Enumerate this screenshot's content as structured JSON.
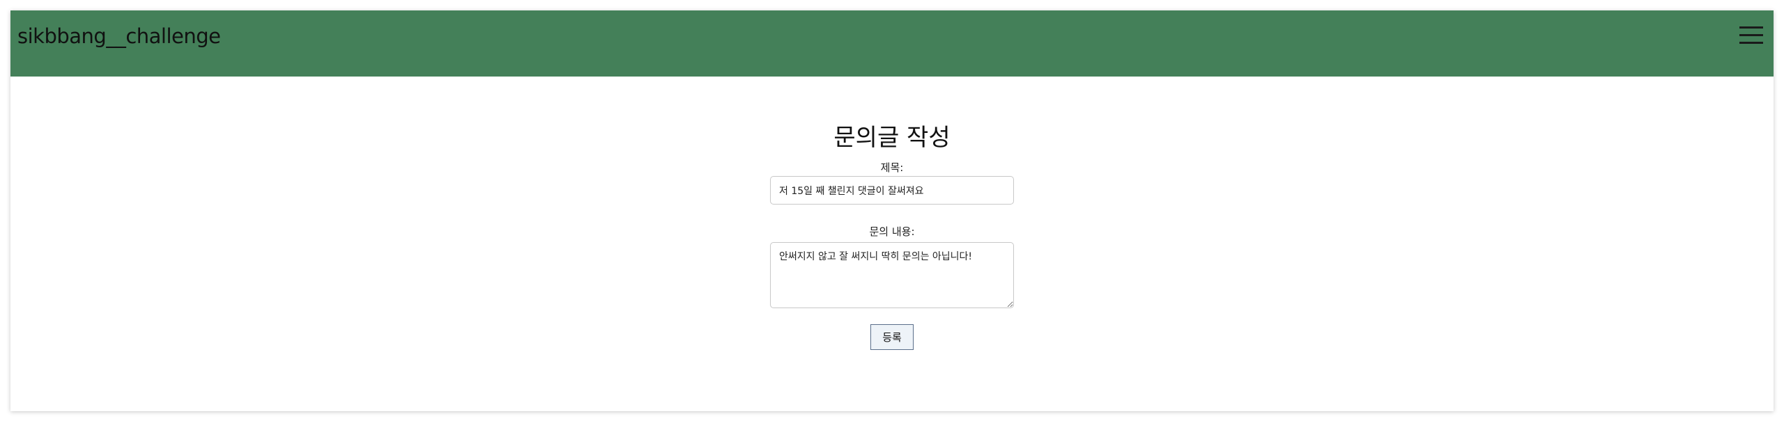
{
  "navbar": {
    "brand": "sikbbang__challenge",
    "menu_icon": "hamburger-menu-icon",
    "background_color": "#448059"
  },
  "form": {
    "heading": "문의글 작성",
    "title_label": "제목:",
    "title_value": "저 15일 째 챌린지 댓글이 잘써져요",
    "content_label": "문의 내용:",
    "content_value": "안써지지 않고 잘 써지니 딱히 문의는 아닙니다!",
    "submit_label": "등록"
  }
}
